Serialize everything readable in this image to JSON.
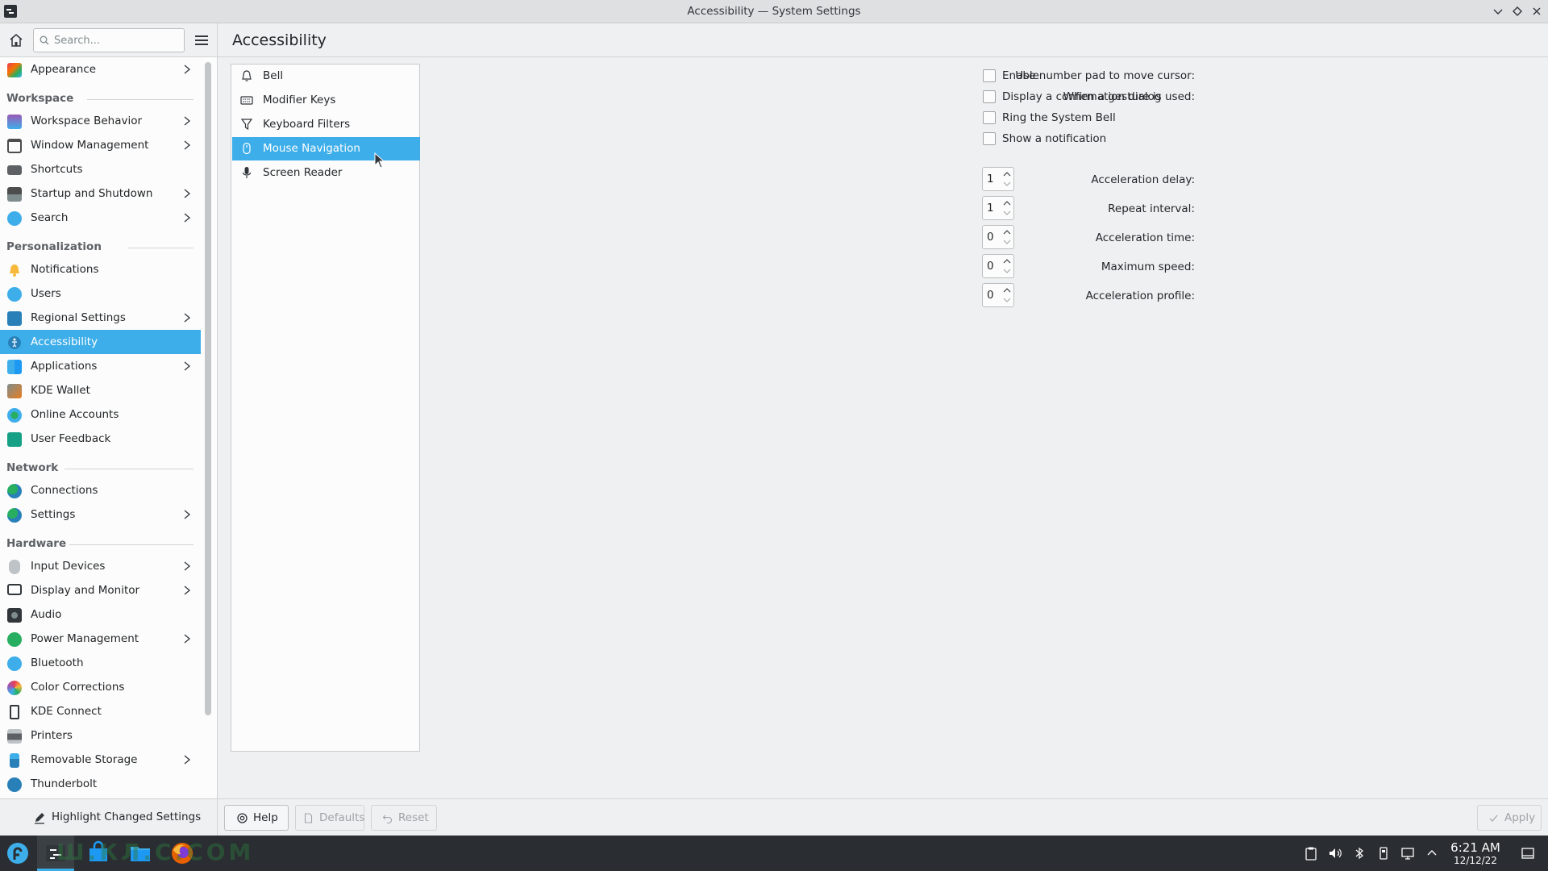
{
  "window": {
    "title": "Accessibility — System Settings",
    "controls": [
      "minimize-icon",
      "maximize-icon",
      "close-icon"
    ]
  },
  "toolbar": {
    "search_placeholder": "Search...",
    "page_title": "Accessibility"
  },
  "sidebar": {
    "top_item": {
      "label": "Appearance",
      "icon": "appearance-icon",
      "has_children": true
    },
    "sections": [
      {
        "title": "Workspace",
        "items": [
          {
            "label": "Workspace Behavior",
            "icon": "workspace-behavior-icon",
            "has_children": true
          },
          {
            "label": "Window Management",
            "icon": "window-management-icon",
            "has_children": true
          },
          {
            "label": "Shortcuts",
            "icon": "keyboard-icon",
            "has_children": false
          },
          {
            "label": "Startup and Shutdown",
            "icon": "startup-icon",
            "has_children": true
          },
          {
            "label": "Search",
            "icon": "search-icon",
            "has_children": true
          }
        ]
      },
      {
        "title": "Personalization",
        "items": [
          {
            "label": "Notifications",
            "icon": "bell-icon",
            "has_children": false
          },
          {
            "label": "Users",
            "icon": "users-icon",
            "has_children": false
          },
          {
            "label": "Regional Settings",
            "icon": "regional-icon",
            "has_children": true
          },
          {
            "label": "Accessibility",
            "icon": "accessibility-icon",
            "has_children": false,
            "selected": true
          },
          {
            "label": "Applications",
            "icon": "applications-icon",
            "has_children": true
          },
          {
            "label": "KDE Wallet",
            "icon": "wallet-icon",
            "has_children": false
          },
          {
            "label": "Online Accounts",
            "icon": "online-accounts-icon",
            "has_children": false
          },
          {
            "label": "User Feedback",
            "icon": "feedback-icon",
            "has_children": false
          }
        ]
      },
      {
        "title": "Network",
        "items": [
          {
            "label": "Connections",
            "icon": "globe-icon",
            "has_children": false
          },
          {
            "label": "Settings",
            "icon": "network-settings-icon",
            "has_children": true
          }
        ]
      },
      {
        "title": "Hardware",
        "items": [
          {
            "label": "Input Devices",
            "icon": "mouse-icon",
            "has_children": true
          },
          {
            "label": "Display and Monitor",
            "icon": "monitor-icon",
            "has_children": true
          },
          {
            "label": "Audio",
            "icon": "speaker-icon",
            "has_children": false
          },
          {
            "label": "Power Management",
            "icon": "power-icon",
            "has_children": true
          },
          {
            "label": "Bluetooth",
            "icon": "bluetooth-icon",
            "has_children": false
          },
          {
            "label": "Color Corrections",
            "icon": "color-icon",
            "has_children": false
          },
          {
            "label": "KDE Connect",
            "icon": "phone-icon",
            "has_children": false
          },
          {
            "label": "Printers",
            "icon": "printer-icon",
            "has_children": false
          },
          {
            "label": "Removable Storage",
            "icon": "usb-icon",
            "has_children": true
          },
          {
            "label": "Thunderbolt",
            "icon": "thunderbolt-icon",
            "has_children": false
          }
        ]
      }
    ],
    "footer_button": "Highlight Changed Settings"
  },
  "subnav": [
    {
      "label": "Bell",
      "icon": "bell-icon"
    },
    {
      "label": "Modifier Keys",
      "icon": "keyboard-icon"
    },
    {
      "label": "Keyboard Filters",
      "icon": "filter-icon"
    },
    {
      "label": "Mouse Navigation",
      "icon": "mouse-icon",
      "selected": true
    },
    {
      "label": "Screen Reader",
      "icon": "microphone-icon"
    }
  ],
  "form": {
    "numpad_label": "Use number pad to move cursor:",
    "enable_label": "Enable",
    "enable_checked": false,
    "gesture_label": "When a gesture is used:",
    "gesture_options": [
      {
        "label": "Display a confirmation dialog",
        "checked": false
      },
      {
        "label": "Ring the System Bell",
        "checked": false
      },
      {
        "label": "Show a notification",
        "checked": false
      }
    ],
    "spinboxes": [
      {
        "label": "Acceleration delay:",
        "value": "1"
      },
      {
        "label": "Repeat interval:",
        "value": "1"
      },
      {
        "label": "Acceleration time:",
        "value": "0"
      },
      {
        "label": "Maximum speed:",
        "value": "0"
      },
      {
        "label": "Acceleration profile:",
        "value": "0"
      }
    ]
  },
  "buttons": {
    "help": "Help",
    "defaults": "Defaults",
    "reset": "Reset",
    "apply": "Apply"
  },
  "taskbar": {
    "watermark": "Ш.КЛ.С.COM",
    "time": "6:21 AM",
    "date": "12/12/22"
  },
  "colors": {
    "accent": "#3daee9",
    "taskbar": "#2a2e32"
  }
}
